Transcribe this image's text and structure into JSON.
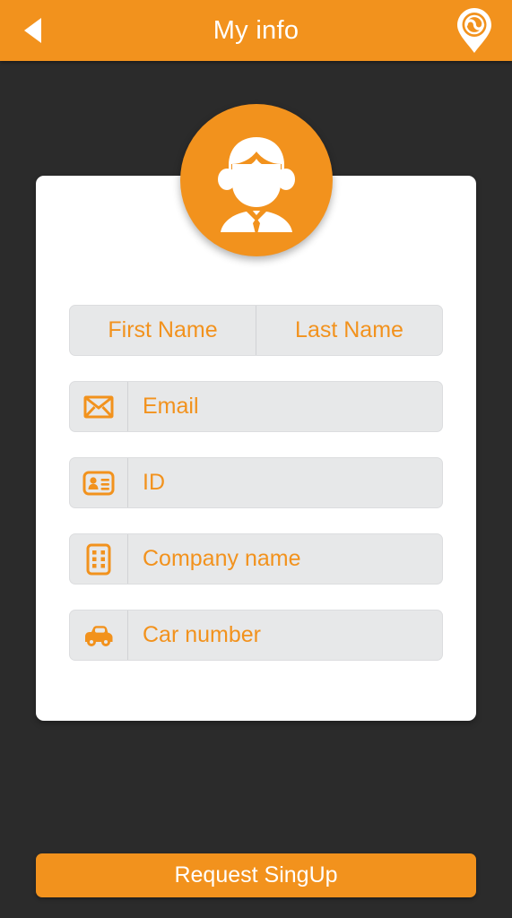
{
  "header": {
    "title": "My info",
    "back_icon": "back-arrow-icon",
    "pin_icon": "location-pin-icon"
  },
  "avatar": {
    "icon": "user-avatar-icon",
    "color": "#f2921d"
  },
  "form": {
    "first_name": {
      "placeholder": "First Name",
      "value": ""
    },
    "last_name": {
      "placeholder": "Last Name",
      "value": ""
    },
    "email": {
      "placeholder": "Email",
      "value": "",
      "icon": "envelope-icon"
    },
    "id": {
      "placeholder": "ID",
      "value": "",
      "icon": "id-card-icon"
    },
    "company": {
      "placeholder": "Company name",
      "value": "",
      "icon": "building-icon"
    },
    "car": {
      "placeholder": "Car number",
      "value": "",
      "icon": "car-icon"
    }
  },
  "actions": {
    "submit_label": "Request SingUp"
  },
  "colors": {
    "accent": "#f2921d",
    "background": "#2b2b2b",
    "card": "#ffffff",
    "field": "#e7e8e9"
  }
}
